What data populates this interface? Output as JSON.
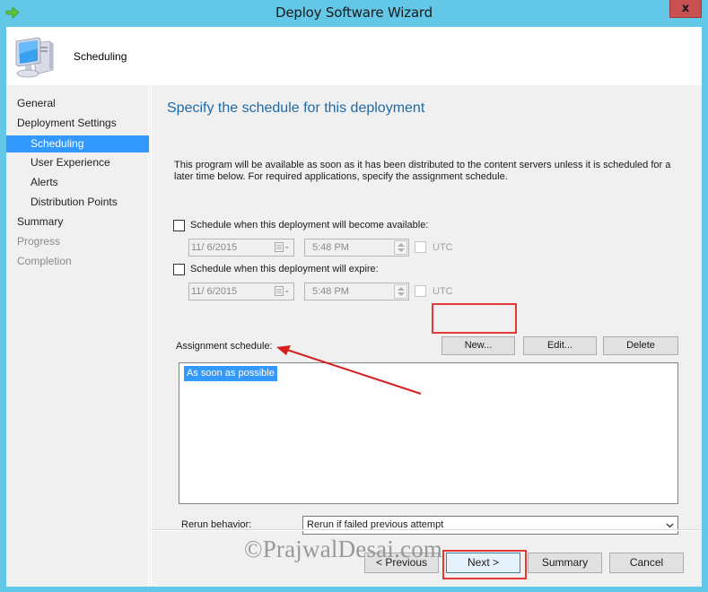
{
  "window": {
    "title": "Deploy Software Wizard",
    "close_label": "x"
  },
  "header": {
    "title": "Scheduling"
  },
  "sidebar": {
    "items": [
      {
        "label": "General",
        "level": 0,
        "state": "normal"
      },
      {
        "label": "Deployment Settings",
        "level": 0,
        "state": "normal"
      },
      {
        "label": "Scheduling",
        "level": 1,
        "state": "active"
      },
      {
        "label": "User Experience",
        "level": 1,
        "state": "normal"
      },
      {
        "label": "Alerts",
        "level": 1,
        "state": "normal"
      },
      {
        "label": "Distribution Points",
        "level": 1,
        "state": "normal"
      },
      {
        "label": "Summary",
        "level": 0,
        "state": "normal"
      },
      {
        "label": "Progress",
        "level": 0,
        "state": "disabled"
      },
      {
        "label": "Completion",
        "level": 0,
        "state": "disabled"
      }
    ]
  },
  "main": {
    "page_title": "Specify the schedule for this deployment",
    "description": "This program will be available as soon as it has been distributed to the content servers unless it is scheduled for a later time below. For required applications, specify the assignment schedule.",
    "available": {
      "checkbox_label": "Schedule when this deployment will become available:",
      "checked": false,
      "date": "11/ 6/2015",
      "time": "5:48 PM",
      "utc_label": "UTC",
      "utc_checked": false
    },
    "expire": {
      "checkbox_label": "Schedule when this deployment will expire:",
      "checked": false,
      "date": "11/ 6/2015",
      "time": "5:48 PM",
      "utc_label": "UTC",
      "utc_checked": false
    },
    "assignment": {
      "label": "Assignment schedule:",
      "new_label": "New...",
      "edit_label": "Edit...",
      "delete_label": "Delete",
      "items": [
        "As soon as possible"
      ],
      "selected_index": 0
    },
    "rerun": {
      "label": "Rerun behavior:",
      "selected": "Rerun if failed previous attempt"
    }
  },
  "footer": {
    "previous_label": "< Previous",
    "next_label": "Next >",
    "summary_label": "Summary",
    "cancel_label": "Cancel"
  },
  "annotations": {
    "highlight_color": "#e53935",
    "watermark": "©PrajwalDesai.com"
  },
  "colors": {
    "title_bar": "#63c7e8",
    "close_button": "#c75050",
    "selection": "#3399ff",
    "page_title": "#1e6aa8"
  }
}
